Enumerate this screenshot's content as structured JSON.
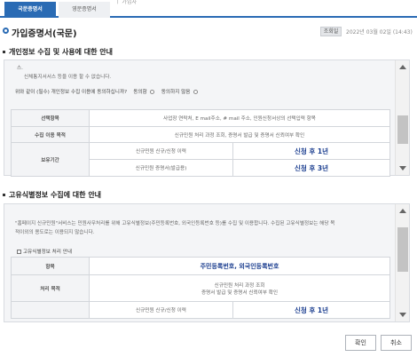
{
  "tabs": [
    {
      "label": "국문증명서"
    },
    {
      "label": "영문증명서"
    }
  ],
  "top_text": "ㅣ 가입자",
  "title": "가입증명서(국문)",
  "view_badge": "조회일",
  "view_date": "2022년 03월 02일 (14:43)",
  "section1": {
    "heading": "개인정보 수집 및 사용에 대한 안내",
    "line_a": "스.",
    "line_b": "신체통지서서스 등을 이용 할 수 없습니다.",
    "consent_question": "위와 같이 (필수) 개인정보 수집 이용에 동의하십니까?",
    "agree": "동의함",
    "disagree": "동의하지 않음",
    "table": {
      "items_label": "선택항목",
      "items_value": "사업장 연락처, E mail주소, # mail 주소, 인원신청서상의 선택입력 항목",
      "purpose_label": "수집 이용 목적",
      "purpose_value": "신규민원 처리 과정 조회, 증명서 발급 및 증명서 신뢰여부 확인",
      "retention_label": "보유기간",
      "row1_left": "신규민원 신규/신청 이력",
      "row1_right": "신청 후 1년",
      "row2_left": "신규민원 증명서(발급용)",
      "row2_right": "신청 후 3년"
    }
  },
  "section2": {
    "heading": "고유식별정보 수집에 대한 안내",
    "para_1": "\"홈페이지 신규민원\"서비스는 민원사무처리를 위해 고유식별정보(주민등록번호, 외국인등록번호 등)를 수집 및 이용합니다. 수집된 고유식별정보는 해당 목",
    "para_2": "적이외의 용도로는 이용되지 않습니다.",
    "subhead": "고유식별정보 처리 안내",
    "table": {
      "item_label": "항목",
      "item_value": "주민등록번호, 외국인등록번호",
      "purpose_label": "처리 목적",
      "purpose_line1": "신규민원 처리 과정 조회",
      "purpose_line2": "증명서 발급 및 증명서 신뢰여부 확인",
      "row_left": "신규민원 신규/신청 이력",
      "row_right": "신청 후 1년"
    }
  },
  "buttons": {
    "confirm": "확인",
    "cancel": "취소"
  }
}
